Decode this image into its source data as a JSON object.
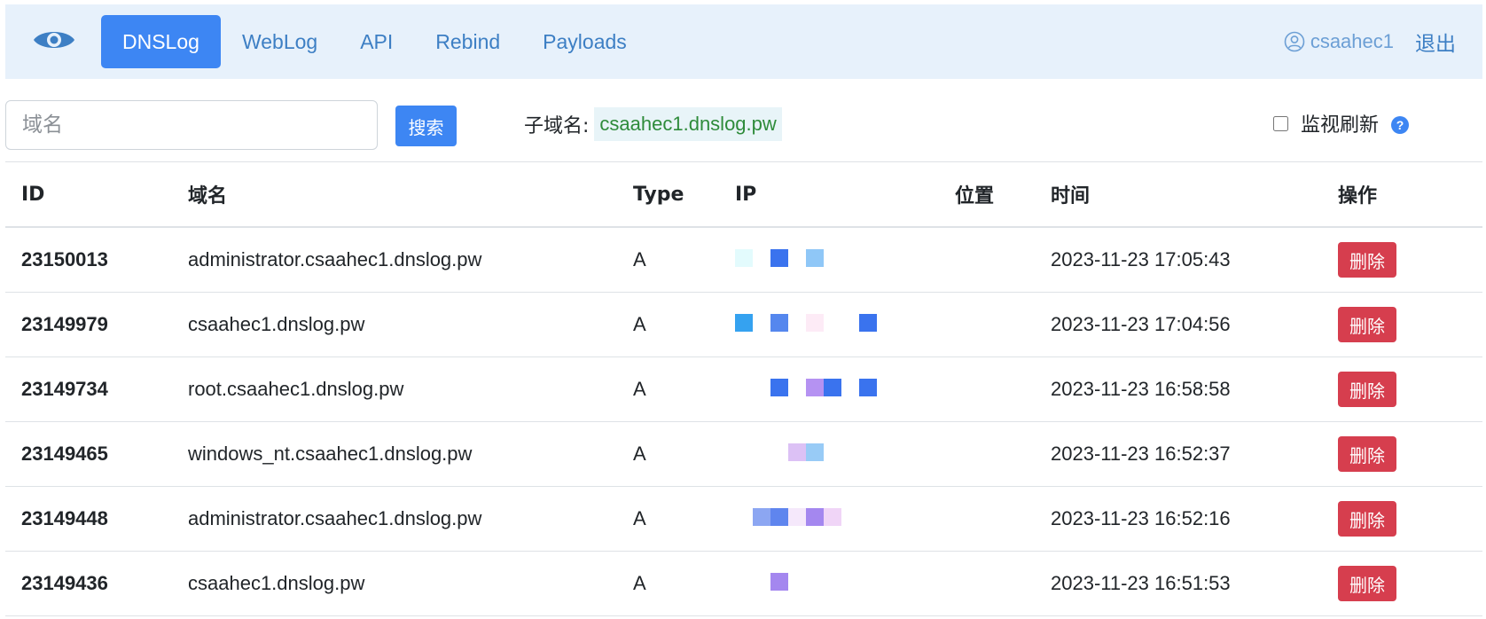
{
  "nav": {
    "brand_icon": "eye-icon",
    "items": [
      {
        "label": "DNSLog",
        "active": true
      },
      {
        "label": "WebLog",
        "active": false
      },
      {
        "label": "API",
        "active": false
      },
      {
        "label": "Rebind",
        "active": false
      },
      {
        "label": "Payloads",
        "active": false
      }
    ],
    "user": {
      "icon": "user-circle-icon",
      "name": "csaahec1"
    },
    "logout_label": "退出"
  },
  "search": {
    "placeholder": "域名",
    "value": "",
    "button_label": "搜索"
  },
  "subdomain": {
    "label": "子域名:",
    "value": "csaahec1.dnslog.pw"
  },
  "monitor": {
    "label": "监视刷新",
    "checked": false,
    "help_icon": "question-circle-icon",
    "help_glyph": "?"
  },
  "table": {
    "headers": [
      "ID",
      "域名",
      "Type",
      "IP",
      "位置",
      "时间",
      "操作"
    ],
    "rows": [
      {
        "id": "23150013",
        "domain": "administrator.csaahec1.dnslog.pw",
        "type": "A",
        "time": "2023-11-23 17:05:43",
        "action": "删除"
      },
      {
        "id": "23149979",
        "domain": "csaahec1.dnslog.pw",
        "type": "A",
        "time": "2023-11-23 17:04:56",
        "action": "删除"
      },
      {
        "id": "23149734",
        "domain": "root.csaahec1.dnslog.pw",
        "type": "A",
        "time": "2023-11-23 16:58:58",
        "action": "删除"
      },
      {
        "id": "23149465",
        "domain": "windows_nt.csaahec1.dnslog.pw",
        "type": "A",
        "time": "2023-11-23 16:52:37",
        "action": "删除"
      },
      {
        "id": "23149448",
        "domain": "administrator.csaahec1.dnslog.pw",
        "type": "A",
        "time": "2023-11-23 16:52:16",
        "action": "删除"
      },
      {
        "id": "23149436",
        "domain": "csaahec1.dnslog.pw",
        "type": "A",
        "time": "2023-11-23 16:51:53",
        "action": "删除"
      }
    ]
  },
  "colors": {
    "accent": "#3d86f3",
    "nav_bg": "#e7f1fb",
    "danger": "#d63e4e",
    "subdomain_text": "#2e8b3a"
  }
}
